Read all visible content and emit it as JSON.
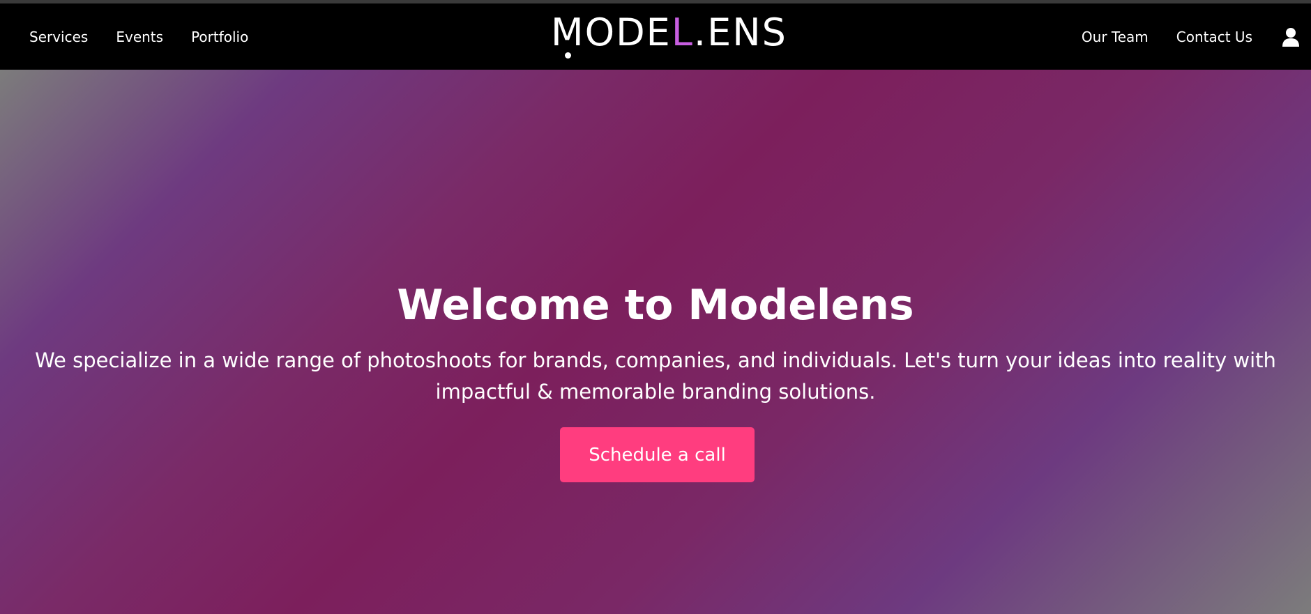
{
  "nav": {
    "left_links": [
      {
        "label": "Services"
      },
      {
        "label": "Events"
      },
      {
        "label": "Portfolio"
      }
    ],
    "right_links": [
      {
        "label": "Our Team"
      },
      {
        "label": "Contact Us"
      }
    ],
    "user_icon": "user-icon"
  },
  "logo": {
    "part1": "M",
    "part2": "ODE",
    "accent": "L",
    "part3": ".ENS",
    "accent_color": "#c75ee0"
  },
  "hero": {
    "title": "Welcome to Modelens",
    "subtitle": "We specialize in a wide range of photoshoots for brands, companies, and individuals. Let's turn your ideas into reality with impactful & memorable branding solutions.",
    "cta_label": "Schedule a call",
    "cta_color": "#ff3d7f"
  },
  "colors": {
    "navbar_bg": "#000000",
    "gradient": [
      "#7c7c7c",
      "#6e3a80",
      "#7c1f5c",
      "#6d3a80",
      "#7c7c7c"
    ]
  }
}
